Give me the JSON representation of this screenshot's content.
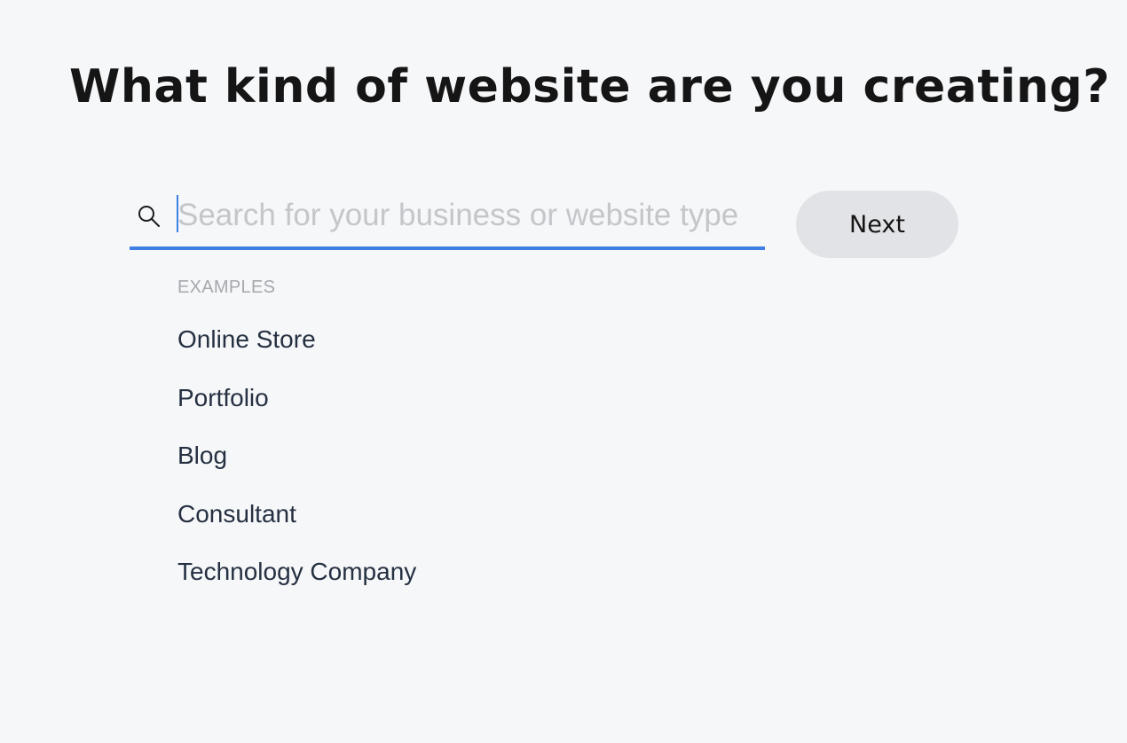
{
  "page": {
    "title": "What kind of website are you creating?"
  },
  "search": {
    "icon": "search-icon",
    "placeholder": "Search for your business or website type",
    "value": "",
    "accent_color": "#3e7fe4"
  },
  "next_button": {
    "label": "Next"
  },
  "examples": {
    "heading": "EXAMPLES",
    "items": [
      {
        "label": "Online Store"
      },
      {
        "label": "Portfolio"
      },
      {
        "label": "Blog"
      },
      {
        "label": "Consultant"
      },
      {
        "label": "Technology Company"
      }
    ]
  }
}
